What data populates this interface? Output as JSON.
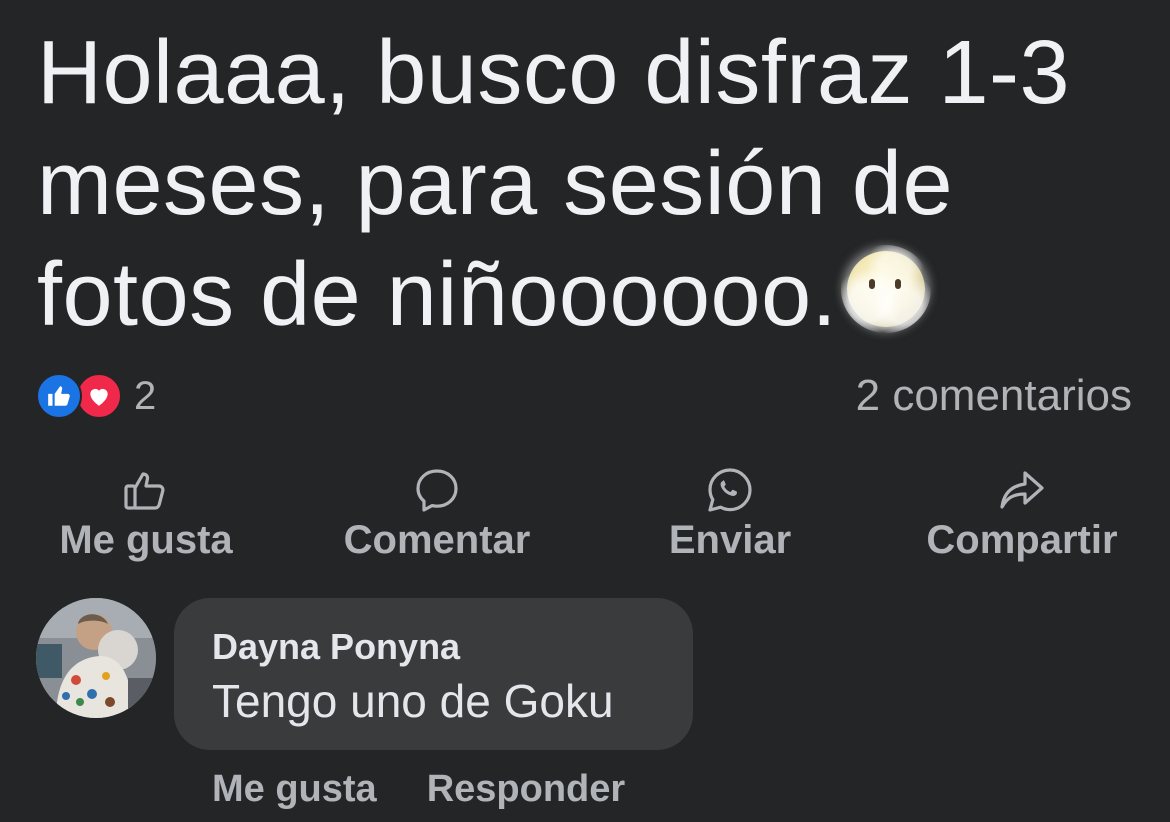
{
  "post": {
    "text": "Holaaa, busco disfraz 1-3 meses, para sesión de fotos de niñoooooo.",
    "emoji": "face-in-clouds-emoji"
  },
  "reactions": {
    "icons": [
      "like-icon",
      "love-icon"
    ],
    "count": "2",
    "comments_count": "2 comentarios",
    "colors": {
      "like": "#1b74e4",
      "love": "#f02849"
    }
  },
  "actions": {
    "like": {
      "label": "Me gusta",
      "icon": "thumbs-up-icon"
    },
    "comment": {
      "label": "Comentar",
      "icon": "speech-bubble-icon"
    },
    "send": {
      "label": "Enviar",
      "icon": "whatsapp-icon"
    },
    "share": {
      "label": "Compartir",
      "icon": "share-arrow-icon"
    }
  },
  "comment": {
    "author": "Dayna Ponyna",
    "text": "Tengo uno de Goku",
    "like_label": "Me gusta",
    "reply_label": "Responder"
  },
  "theme": {
    "background": "#242526",
    "bubble": "#3a3b3c",
    "text_primary": "#e4e6eb",
    "text_secondary": "#b0b3b8"
  }
}
